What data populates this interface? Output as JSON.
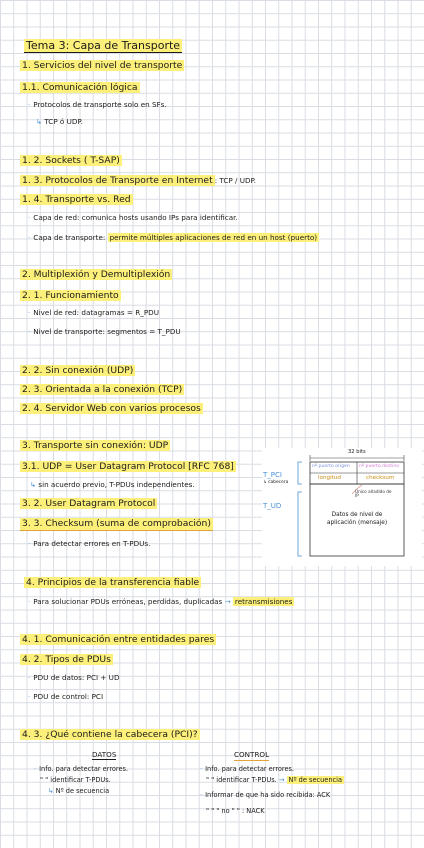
{
  "title": "Tema 3: Capa de Transporte",
  "s1": "1. Servicios del nivel de transporte",
  "s11": "1.1. Comunicación lógica",
  "s11_b1": "Protocolos de transporte solo en SFs.",
  "s11_b1_sub": "TCP ó UDP.",
  "s12": "1. 2. Sockets ( T-SAP)",
  "s13": "1. 3. Protocolos de Transporte en Internet",
  "s13_tail": ": TCP / UDP.",
  "s14": "1. 4. Transporte vs. Red",
  "s14_b1_a": "Capa de red:",
  "s14_b1_b": "comunica hosts usando IPs para identificar.",
  "s14_b2_a": "Capa de transporte:",
  "s14_b2_b": "permite múltiples aplicaciones de red en un host (puerto)",
  "s2": "2. Multiplexión y Demultiplexión",
  "s21": "2. 1. Funcionamiento",
  "s21_b1": "Nivel de red: datagramas = R_PDU",
  "s21_b2": "Nivel de transporte: segmentos = T_PDU",
  "s22": "2. 2. Sin conexión (UDP)",
  "s23": "2. 3. Orientada a la conexión (TCP)",
  "s24": "2. 4. Servidor Web con varios procesos",
  "s3": "3. Transporte sin conexión: UDP",
  "s31": "3.1. UDP = User Datagram Protocol [RFC 768]",
  "s31_sub": "sin acuerdo previo, T-PDUs independientes.",
  "s32": "3. 2. User Datagram Protocol",
  "s33": "3. 3. Checksum (suma de comprobación)",
  "s33_b1": "Para detectar errores en T-PDUs.",
  "s4": "4. Principios de la transferencia fiable",
  "s4_b1_a": "Para solucionar PDUs erróneas, perdidas, duplicadas",
  "s4_b1_b": "retransmisiones",
  "s41": "4. 1. Comunicación entre entidades pares",
  "s42": "4. 2. Tipos de PDUs",
  "s42_b1": "PDU de datos: PCI + UD",
  "s42_b2": "PDU de control: PCI",
  "s43": "4. 3. ¿Qué contiene la cabecera (PCI)?",
  "col_datos": "DATOS",
  "col_control": "CONTROL",
  "datos_b1": "Info. para detectar errores.",
  "datos_b2": "\"     \"   identificar T-PDUs.",
  "datos_sub": "Nº de secuencia",
  "control_b1": "Info. para detectar errores.",
  "control_b2_a": "\"     \"   identificar T-PDUs.",
  "control_b2_b": "Nº de secuencia",
  "control_b3": "Informar de que ha sido recibida: ACK",
  "control_b4": "\"        \"    \"  no  \"     \"       : NACK",
  "diagram": {
    "bits_label": "32 bits",
    "t_pci": "T_PCI",
    "t_pci_note": "↳ cabecera",
    "t_ud": "T_UD",
    "field_src": "nº puerto origen",
    "field_dst": "nº puerto destino",
    "field_len": "longitud",
    "field_chk": "checksum",
    "data_label": "Datos de nivel de aplicación (mensaje)",
    "hdr_note": "Único añadido de IP",
    "colors": {
      "src": "#7b8fe0",
      "dst": "#d67bd6",
      "len": "#e0a030",
      "chk": "#e0a030"
    }
  }
}
